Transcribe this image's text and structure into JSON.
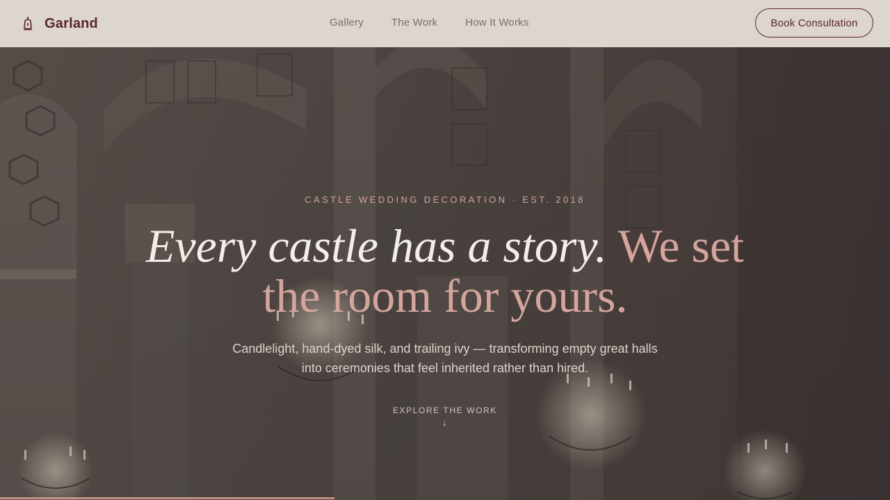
{
  "brand": {
    "name": "Garland",
    "icon": "lantern-icon"
  },
  "nav": {
    "items": [
      {
        "label": "Gallery"
      },
      {
        "label": "The Work"
      },
      {
        "label": "How It Works"
      }
    ]
  },
  "cta": {
    "label": "Book Consultation"
  },
  "hero": {
    "eyebrow": "CASTLE WEDDING DECORATION · EST. 2018",
    "headline_part1": "Every castle has a story.",
    "headline_part2": "We set the room for yours.",
    "subhead": "Candlelight, hand-dyed silk, and trailing ivy — transforming empty great halls into ceremonies that feel inherited rather than hired.",
    "explore_label": "EXPLORE THE WORK",
    "explore_icon": "arrow-down-icon"
  },
  "scroll_progress": 0.376,
  "colors": {
    "header_bg": "#ddd5cf",
    "brand": "#5b2532",
    "accent": "#d3a59c",
    "nav_text": "#7c6d69",
    "headline_light": "#f4eeea"
  }
}
